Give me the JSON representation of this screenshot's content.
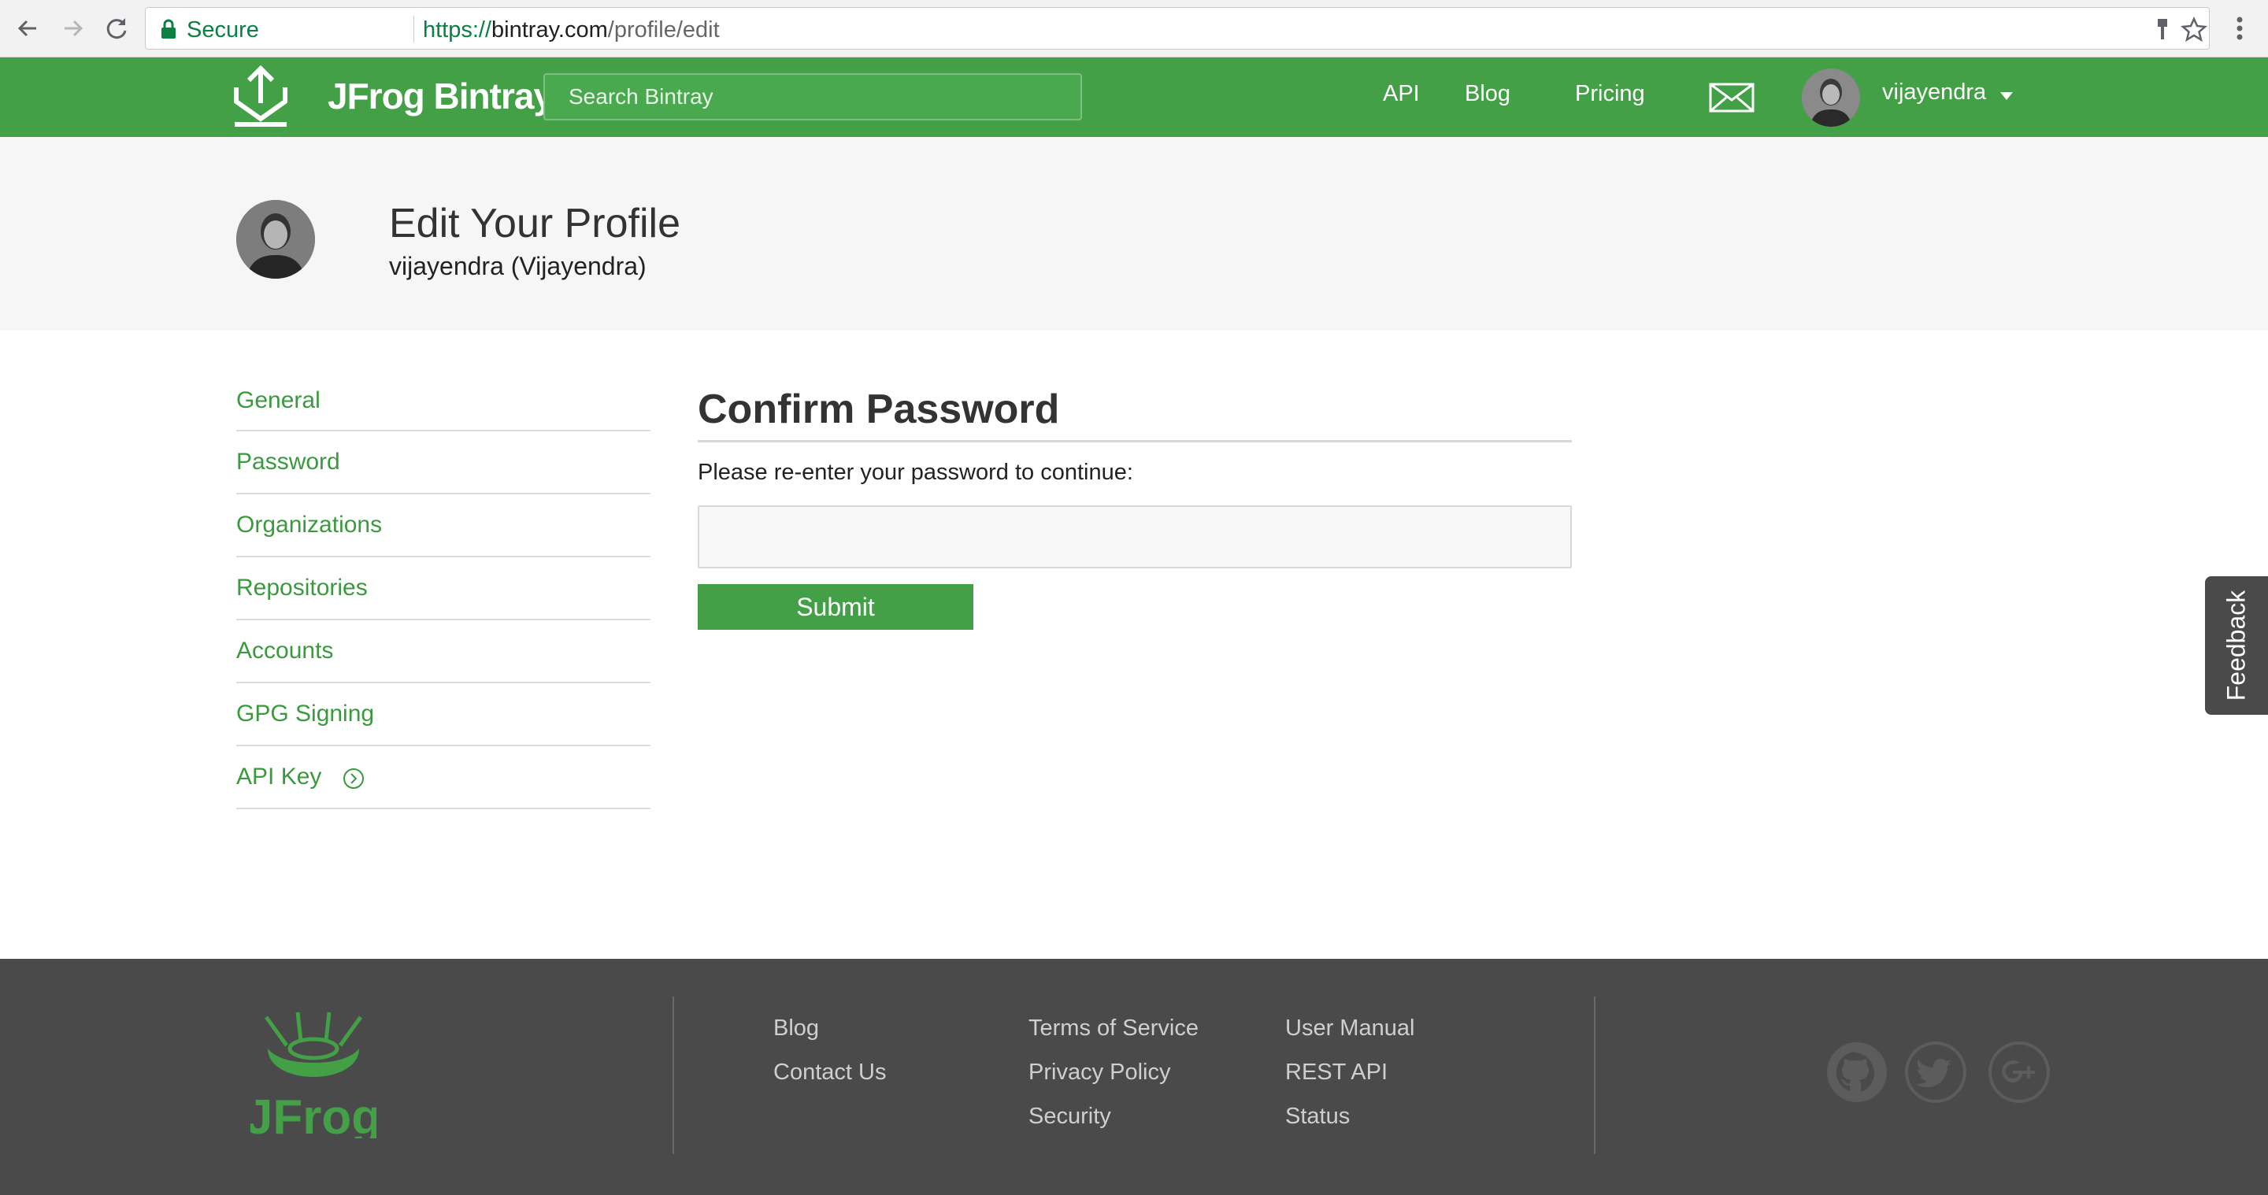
{
  "browser": {
    "secure_label": "Secure",
    "url_scheme": "https://",
    "url_host": "bintray.com",
    "url_path": "/profile/edit"
  },
  "header": {
    "brand": "JFrog Bintray",
    "search_placeholder": "Search Bintray",
    "nav": [
      "API",
      "Blog",
      "Pricing"
    ],
    "username": "vijayendra",
    "brand_color": "#43a047"
  },
  "profile": {
    "title": "Edit Your Profile",
    "subtitle": "vijayendra (Vijayendra)"
  },
  "sidebar": {
    "items": [
      {
        "label": "General"
      },
      {
        "label": "Password"
      },
      {
        "label": "Organizations"
      },
      {
        "label": "Repositories"
      },
      {
        "label": "Accounts"
      },
      {
        "label": "GPG Signing"
      },
      {
        "label": "API Key",
        "icon": "circle-arrow-right-icon"
      }
    ]
  },
  "main": {
    "section_title": "Confirm Password",
    "prompt": "Please re-enter your password to continue:",
    "password_value": "",
    "submit_label": "Submit"
  },
  "feedback": {
    "label": "Feedback"
  },
  "footer": {
    "col1": [
      "Blog",
      "Contact Us"
    ],
    "col2": [
      "Terms of Service",
      "Privacy Policy",
      "Security"
    ],
    "col3": [
      "User Manual",
      "REST API",
      "Status"
    ],
    "social": [
      "github-icon",
      "twitter-icon",
      "google-plus-icon"
    ]
  }
}
